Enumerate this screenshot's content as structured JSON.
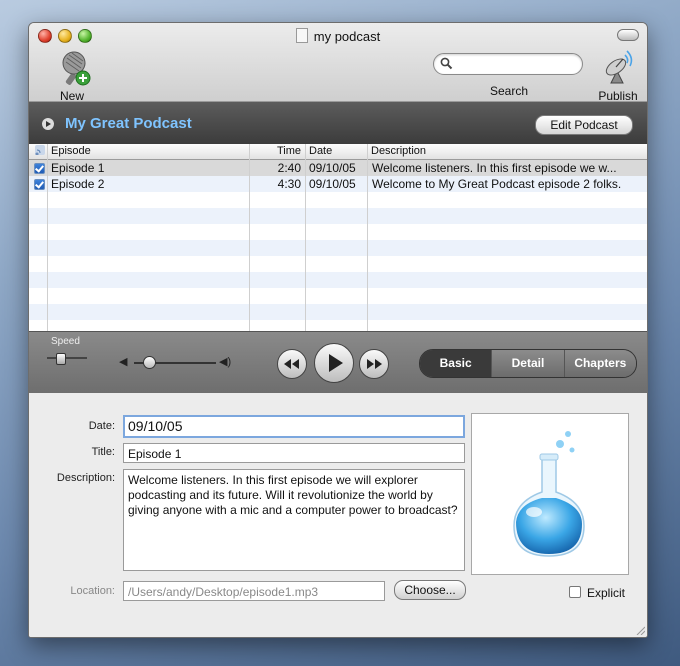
{
  "window": {
    "title": "my podcast"
  },
  "toolbar": {
    "new_episode_label": "New Episode",
    "search_label": "Search",
    "search_value": "",
    "publish_label": "Publish"
  },
  "podcast": {
    "title": "My Great Podcast",
    "edit_button_label": "Edit Podcast",
    "title_color": "#7fc4ff"
  },
  "table": {
    "columns": [
      "Episode",
      "Time",
      "Date",
      "Description"
    ],
    "rows": [
      {
        "checked": true,
        "episode": "Episode 1",
        "time": "2:40",
        "date": "09/10/05",
        "description": "Welcome listeners. In this first episode we w..."
      },
      {
        "checked": true,
        "episode": "Episode 2",
        "time": "4:30",
        "date": "09/10/05",
        "description": "Welcome to My Great Podcast episode 2 folks."
      }
    ]
  },
  "player": {
    "speed_label": "Speed",
    "tabs": [
      "Basic",
      "Detail",
      "Chapters"
    ],
    "selected_tab": "Basic"
  },
  "details": {
    "date_label": "Date:",
    "date_value": "09/10/05",
    "title_label": "Title:",
    "title_value": "Episode 1",
    "description_label": "Description:",
    "description_value": "Welcome listeners. In this first episode we will explorer podcasting and its future. Will it revolutionize the world by giving anyone with a mic and a computer power to broadcast?",
    "location_label": "Location:",
    "location_value": "/Users/andy/Desktop/episode1.mp3",
    "choose_button_label": "Choose...",
    "explicit_label": "Explicit",
    "explicit_checked": false
  },
  "icons": {
    "new_episode": "microphone-plus-icon",
    "search": "magnifier-icon",
    "publish": "satellite-dish-icon",
    "artwork": "flask-icon"
  }
}
